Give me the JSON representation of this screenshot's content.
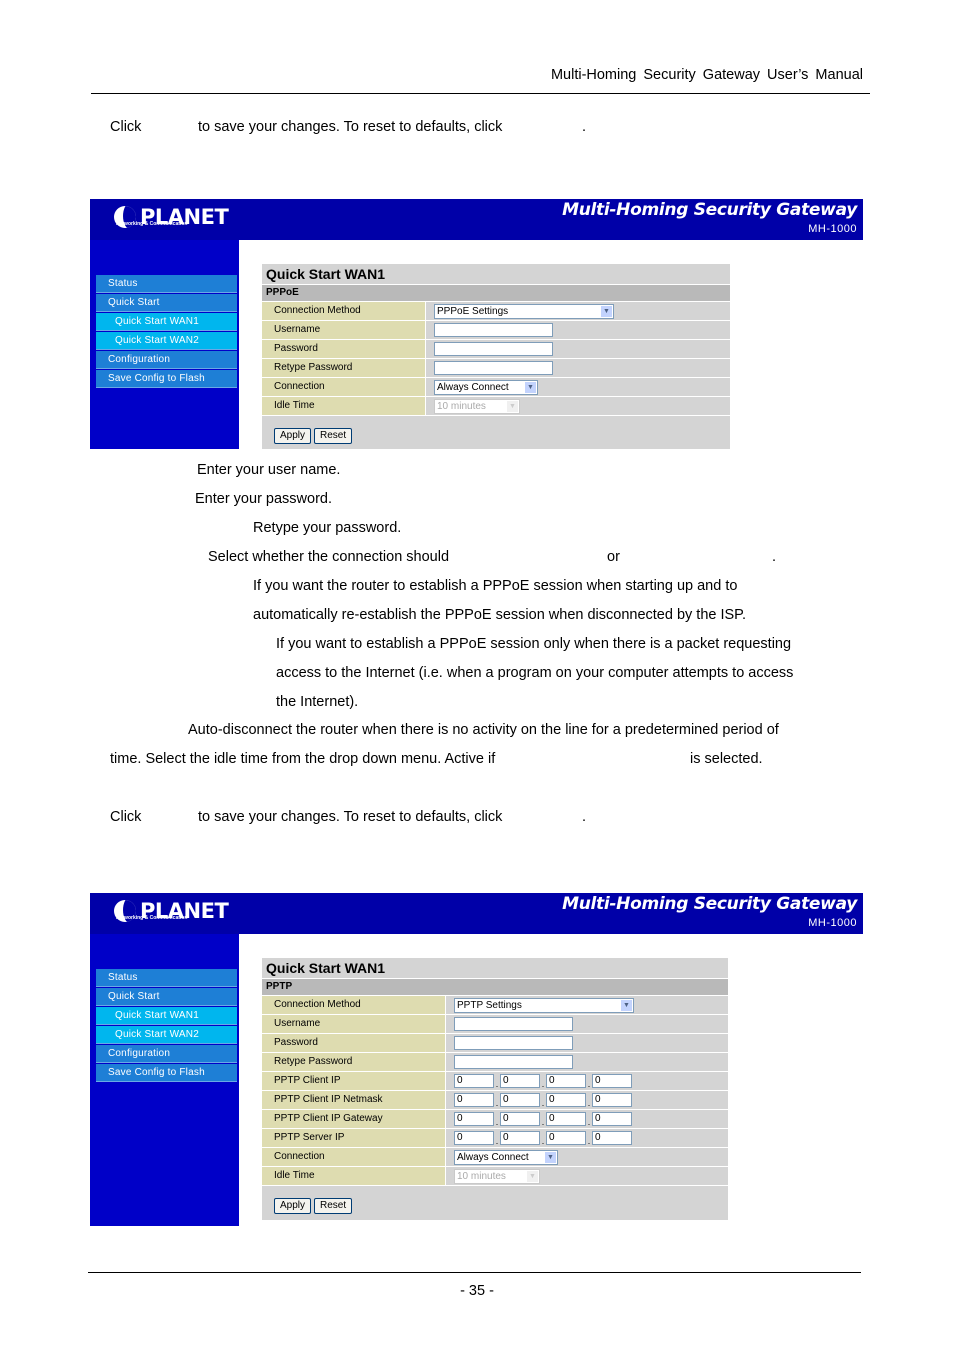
{
  "header": {
    "title": "Multi-Homing  Security  Gateway  User’s  Manual"
  },
  "instructions": {
    "click_save_1": {
      "click": "Click",
      "rest": "to save your changes. To reset to defaults, click",
      "period": "."
    },
    "click_save_2": {
      "click": "Click",
      "rest": "to save your changes. To reset to defaults, click",
      "period": "."
    }
  },
  "descriptions": {
    "username": "Enter your user name.",
    "password": "Enter your password.",
    "retype": "Retype your password.",
    "connection": "Select whether the connection should",
    "connection_or": "or",
    "connection_period": ".",
    "always_connect_1": "If you want the router to establish a PPPoE session when starting up and to",
    "always_connect_2": "automatically re-establish the PPPoE session when disconnected by the ISP.",
    "on_demand_1": "If you want to establish a PPPoE session only when there is a packet requesting",
    "on_demand_2": "access to the Internet (i.e. when a program on your computer attempts to access",
    "on_demand_3": "the Internet).",
    "idle_1": "Auto-disconnect the router when there is no activity on the line for a predetermined period of",
    "idle_2a": "time. Select the idle time from the drop down menu. Active if",
    "idle_2b": "is selected."
  },
  "gateway": {
    "logo_text": "PLANET",
    "logo_sub": "Networking & Communication",
    "product_title": "Multi-Homing Security Gateway",
    "model": "MH-1000",
    "nav": [
      {
        "label": "Status"
      },
      {
        "label": "Quick Start"
      },
      {
        "label": "Quick Start WAN1"
      },
      {
        "label": "Quick Start WAN2"
      },
      {
        "label": "Configuration"
      },
      {
        "label": "Save Config to Flash"
      }
    ],
    "colors": {
      "top_bar": "#0000a8",
      "sidebar": "#0000c8",
      "nav_item": "#1e7fd6",
      "nav_sub": "#00b6ee",
      "label_cell": "#dedcb0",
      "panel": "#d4d4d4"
    }
  },
  "pppoe": {
    "title": "Quick Start WAN1",
    "section": "PPPoE",
    "fields": {
      "connection_method": {
        "label": "Connection Method",
        "value": "PPPoE Settings"
      },
      "username": {
        "label": "Username",
        "value": ""
      },
      "password": {
        "label": "Password",
        "value": ""
      },
      "retype": {
        "label": "Retype Password",
        "value": ""
      },
      "connection": {
        "label": "Connection",
        "value": "Always Connect"
      },
      "idle": {
        "label": "Idle Time",
        "value": "10 minutes"
      }
    },
    "apply": "Apply",
    "reset": "Reset"
  },
  "pptp": {
    "title": "Quick Start WAN1",
    "section": "PPTP",
    "fields": {
      "connection_method": {
        "label": "Connection Method",
        "value": "PPTP Settings"
      },
      "username": {
        "label": "Username",
        "value": ""
      },
      "password": {
        "label": "Password",
        "value": ""
      },
      "retype": {
        "label": "Retype Password",
        "value": ""
      },
      "client_ip": {
        "label": "PPTP Client IP",
        "octets": [
          "0",
          "0",
          "0",
          "0"
        ]
      },
      "client_netmask": {
        "label": "PPTP Client IP Netmask",
        "octets": [
          "0",
          "0",
          "0",
          "0"
        ]
      },
      "client_gateway": {
        "label": "PPTP Client IP Gateway",
        "octets": [
          "0",
          "0",
          "0",
          "0"
        ]
      },
      "server_ip": {
        "label": "PPTP Server IP",
        "octets": [
          "0",
          "0",
          "0",
          "0"
        ]
      },
      "connection": {
        "label": "Connection",
        "value": "Always Connect"
      },
      "idle": {
        "label": "Idle Time",
        "value": "10 minutes"
      }
    },
    "apply": "Apply",
    "reset": "Reset"
  },
  "footer": {
    "page_number": "- 35 -"
  }
}
